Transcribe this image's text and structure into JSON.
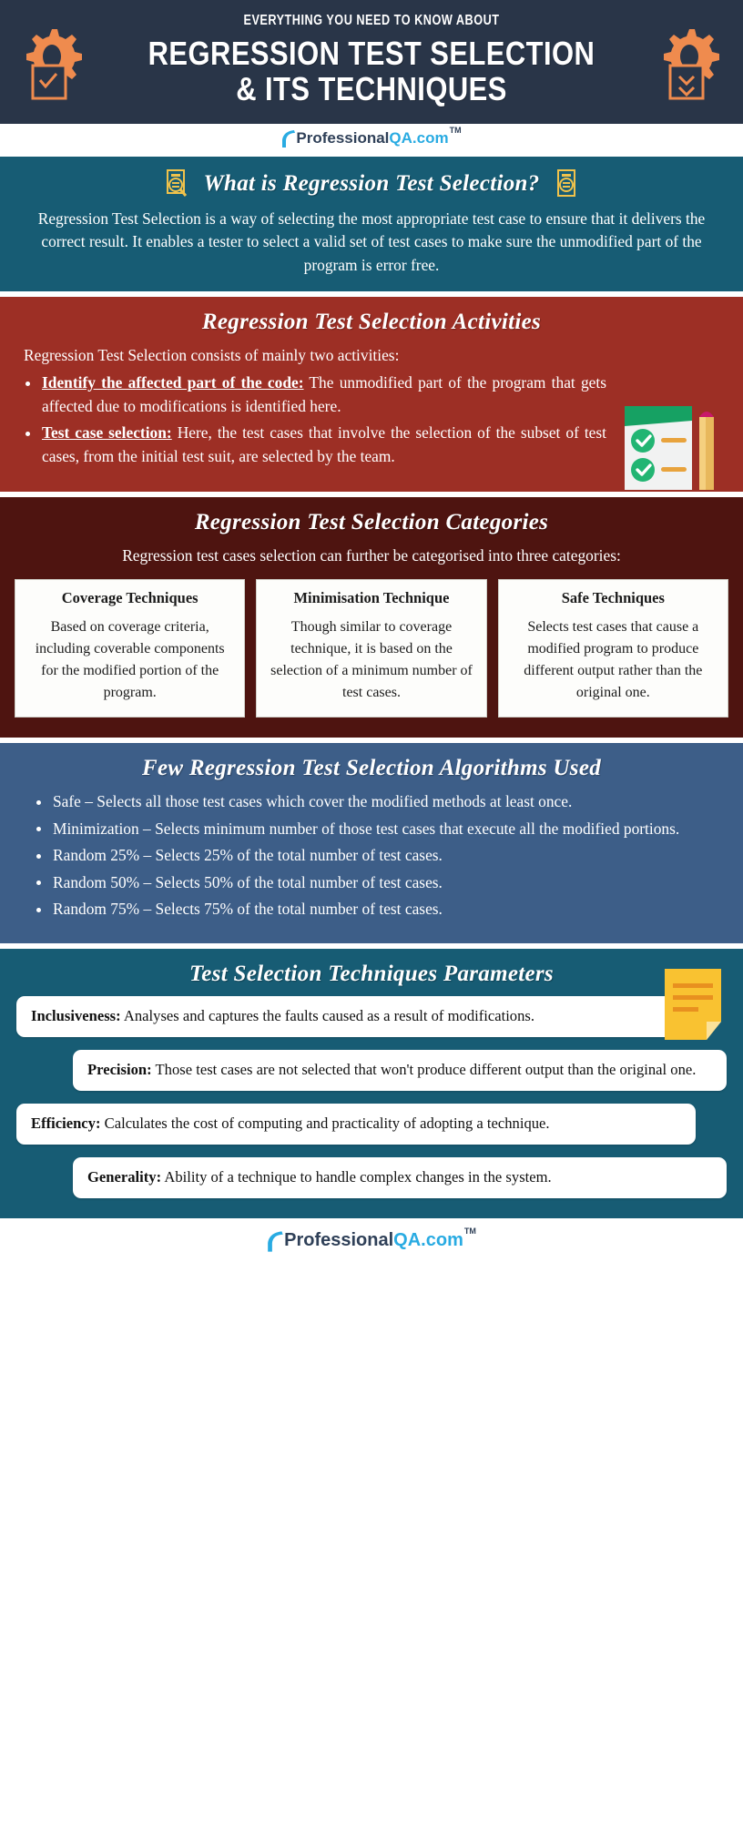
{
  "header": {
    "kicker": "EVERYTHING YOU NEED TO KNOW ABOUT",
    "title": "REGRESSION TEST SELECTION & ITS TECHNIQUES",
    "left_icon": "gear-with-checkbox-icon",
    "right_icon": "gear-with-download-box-icon",
    "bg_color": "#293548",
    "accent_color": "#ef8b4e"
  },
  "logo": {
    "part1": "Professional",
    "part2": "QA",
    "part3": ".com",
    "tm": "TM",
    "color_dark": "#2f4058",
    "color_blue": "#29abe2"
  },
  "intro": {
    "title": "What is Regression Test Selection?",
    "left_icon": "document-search-icon",
    "right_icon": "document-icon",
    "body": "Regression Test Selection is a way of selecting the most appropriate test case to ensure that it delivers the correct result. It enables a tester to select a valid set of test cases to make sure the unmodified part of the program is error free.",
    "bg_color": "#175c74"
  },
  "activities": {
    "title": "Regression Test Selection Activities",
    "lead": "Regression Test Selection consists of mainly two activities:",
    "items": [
      {
        "label": "Identify the affected part of the code:",
        "text": " The unmodified part of the program that gets affected due to modifications is identified here."
      },
      {
        "label": "Test case selection:",
        "text": " Here, the test cases that involve the selection of the subset of test cases, from the initial test suit, are selected by the team."
      }
    ],
    "image": "checklist-with-pencil-illustration",
    "bg_color": "#9d2f25"
  },
  "categories": {
    "title": "Regression Test Selection Categories",
    "lead": "Regression test  cases selection can further be categorised into three categories:",
    "cards": [
      {
        "title": "Coverage Techniques",
        "text": "Based on coverage criteria, including coverable components for the modified portion of the program."
      },
      {
        "title": "Minimisation Technique",
        "text": "Though similar to coverage technique, it is based on the selection of a minimum number of test cases."
      },
      {
        "title": "Safe Techniques",
        "text": "Selects test cases that cause a modified program to produce different output rather than the original one."
      }
    ],
    "bg_color": "#4e1410"
  },
  "algorithms": {
    "title": "Few Regression Test Selection Algorithms Used",
    "items": [
      "Safe – Selects all those test cases which cover the modified methods at least once.",
      "Minimization – Selects minimum number of those test cases that execute all the modified portions.",
      "Random 25% – Selects 25% of the total number of test cases.",
      "Random 50% – Selects 50% of the total number of test cases.",
      "Random 75% – Selects 75% of the total number of test cases."
    ],
    "bg_color": "#3d5e88"
  },
  "parameters": {
    "title": "Test Selection Techniques Parameters",
    "image": "yellow-note-icon",
    "items": [
      {
        "label": "Inclusiveness:",
        "text": " Analyses and captures the faults caused as a result of modifications."
      },
      {
        "label": "Precision:",
        "text": " Those test cases are not selected that won't produce different output than the original one."
      },
      {
        "label": "Efficiency:",
        "text": " Calculates the cost of computing and practicality of adopting a technique."
      },
      {
        "label": " Generality:",
        "text": " Ability of a technique to handle complex changes in the system."
      }
    ],
    "bg_color": "#175c74"
  }
}
